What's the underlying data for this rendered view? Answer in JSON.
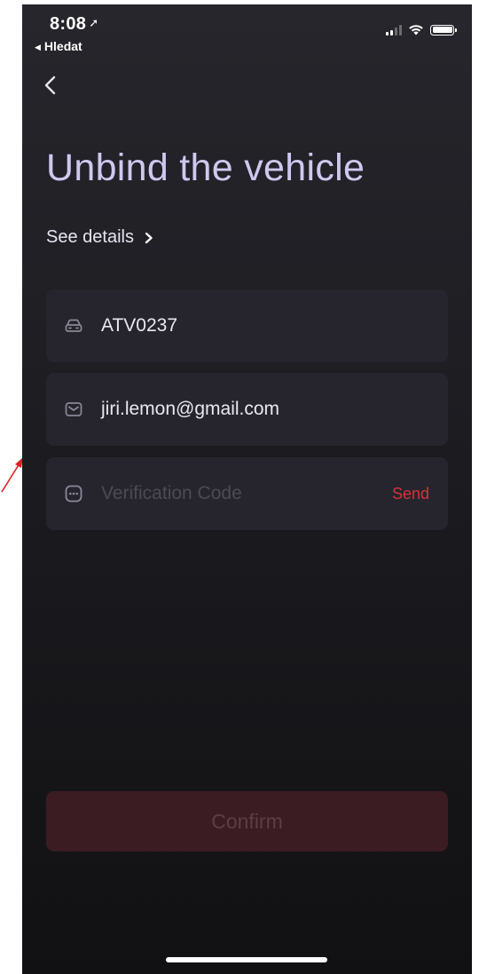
{
  "status_bar": {
    "time": "8:08",
    "location_icon": "location-arrow-icon",
    "back_app_label": "Hledat",
    "signal_icon": "cellular-signal-icon",
    "wifi_icon": "wifi-icon",
    "battery_icon": "battery-icon"
  },
  "nav": {
    "back_icon": "chevron-left-icon"
  },
  "page": {
    "title": "Unbind the vehicle",
    "see_details_label": "See details",
    "see_details_icon": "chevron-right-icon"
  },
  "form": {
    "vehicle": {
      "icon": "car-icon",
      "value": "ATV0237"
    },
    "email": {
      "icon": "envelope-icon",
      "value": "jiri.lemon@gmail.com"
    },
    "code": {
      "icon": "message-code-icon",
      "value": "",
      "placeholder": "Verification Code",
      "send_label": "Send"
    }
  },
  "confirm_label": "Confirm",
  "colors": {
    "title": "#cfc8ee",
    "accent_red": "#d8313c",
    "confirm_bg_disabled": "#3b1c22",
    "field_bg": "#26252d"
  }
}
